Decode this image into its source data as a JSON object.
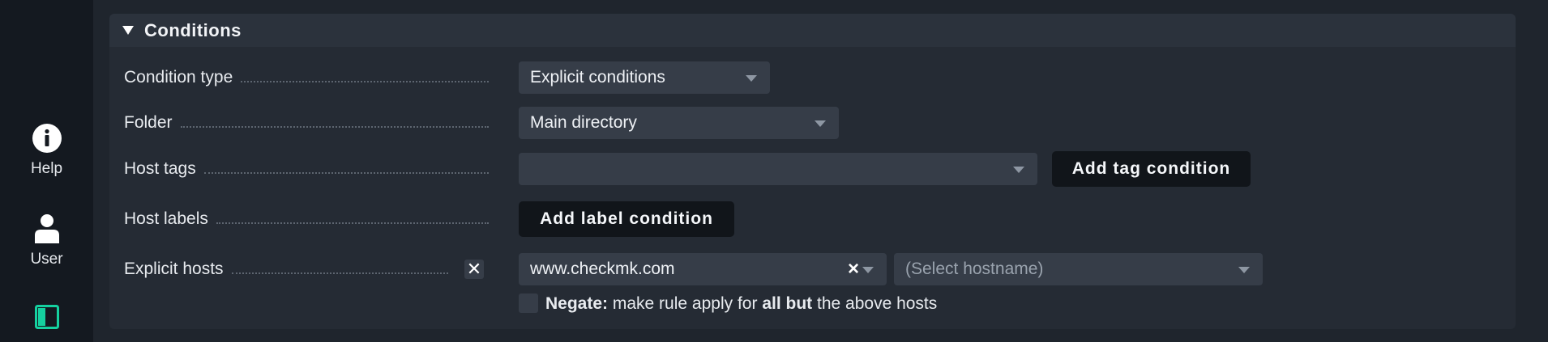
{
  "sidebar": {
    "help_label": "Help",
    "user_label": "User",
    "toggle_icon_color": "#15d1a0"
  },
  "conditions": {
    "title": "Conditions",
    "condition_type": {
      "label": "Condition type",
      "value": "Explicit conditions"
    },
    "folder": {
      "label": "Folder",
      "value": "Main directory"
    },
    "host_tags": {
      "label": "Host tags",
      "value": "",
      "button": "Add tag condition"
    },
    "host_labels": {
      "label": "Host labels",
      "button": "Add label condition"
    },
    "explicit_hosts": {
      "label": "Explicit hosts",
      "clear_glyph": "✕",
      "host_value": "www.checkmk.com",
      "host_clear_glyph": "×",
      "placeholder": "(Select hostname)",
      "negate_bold": "Negate:",
      "negate_text_1": "make rule apply for",
      "negate_bold_2": "all but",
      "negate_text_2": "the above hosts",
      "negate_checked": false
    }
  }
}
